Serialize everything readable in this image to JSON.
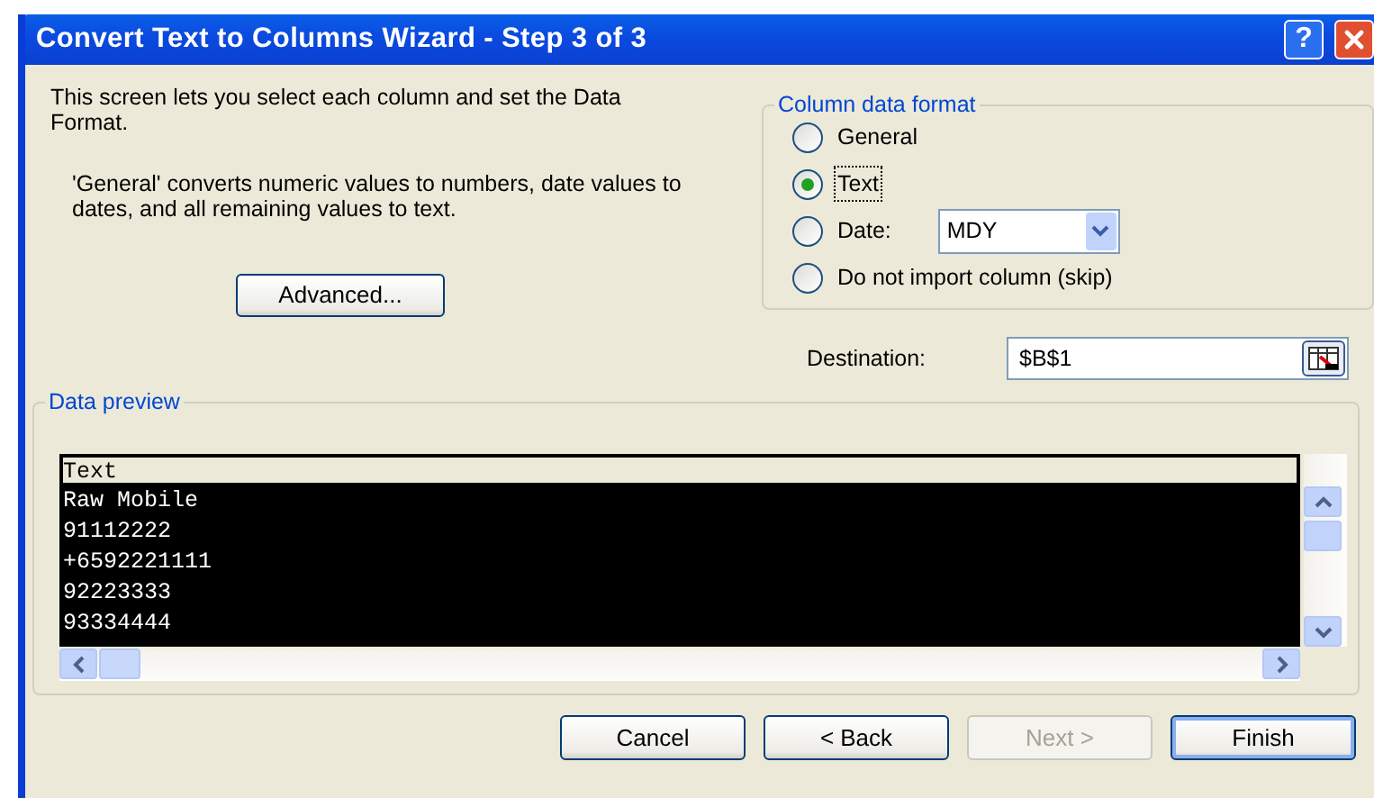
{
  "window": {
    "title": "Convert Text to Columns Wizard - Step 3 of 3",
    "help_button": "?"
  },
  "description": "This screen lets you select each column and set the Data Format.",
  "note": "'General' converts numeric values to numbers, date values to dates, and all remaining values to text.",
  "advanced_button": "Advanced...",
  "column_data_format": {
    "title": "Column data format",
    "options": [
      {
        "label": "General",
        "selected": false,
        "focused": false
      },
      {
        "label": "Text",
        "selected": true,
        "focused": true
      },
      {
        "label": "Date:",
        "selected": false,
        "focused": false,
        "kind": "date",
        "dropdown": "MDY"
      },
      {
        "label": "Do not import column (skip)",
        "selected": false,
        "focused": false
      }
    ]
  },
  "destination": {
    "label": "Destination:",
    "value": "$B$1"
  },
  "data_preview": {
    "title": "Data preview",
    "header": "Text",
    "column_selected": true,
    "rows": [
      "Raw Mobile",
      "91112222",
      "+6592221111",
      "92223333",
      "93334444"
    ]
  },
  "buttons": [
    {
      "label": "Cancel",
      "disabled": false,
      "default": false
    },
    {
      "label": "< Back",
      "disabled": false,
      "default": false
    },
    {
      "label": "Next >",
      "disabled": true,
      "default": false
    },
    {
      "label": "Finish",
      "disabled": false,
      "default": true
    }
  ]
}
